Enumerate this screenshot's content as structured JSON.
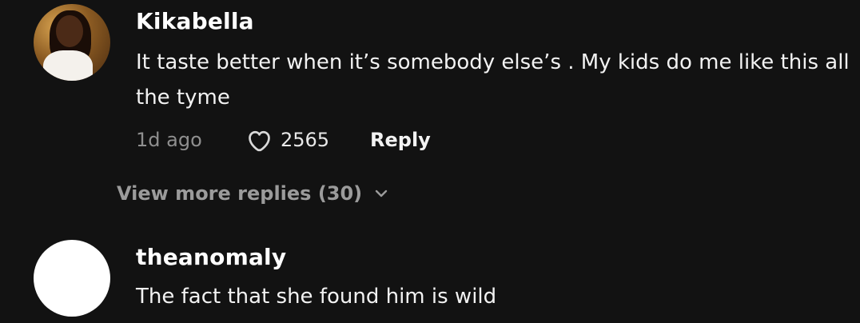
{
  "comments": [
    {
      "username": "Kikabella",
      "text": "It taste better when it’s somebody else’s . My kids do me like this all the tyme",
      "timestamp": "1d ago",
      "likes": "2565",
      "reply_label": "Reply",
      "view_more_label": "View more replies (30)"
    },
    {
      "username": "theanomaly",
      "text": "The fact that she found him is wild"
    }
  ],
  "icons": {
    "like": "heart-icon",
    "expand": "chevron-down-icon"
  },
  "colors": {
    "background": "#121212",
    "text_primary": "#ffffff",
    "text_secondary": "#8f8f8f"
  }
}
